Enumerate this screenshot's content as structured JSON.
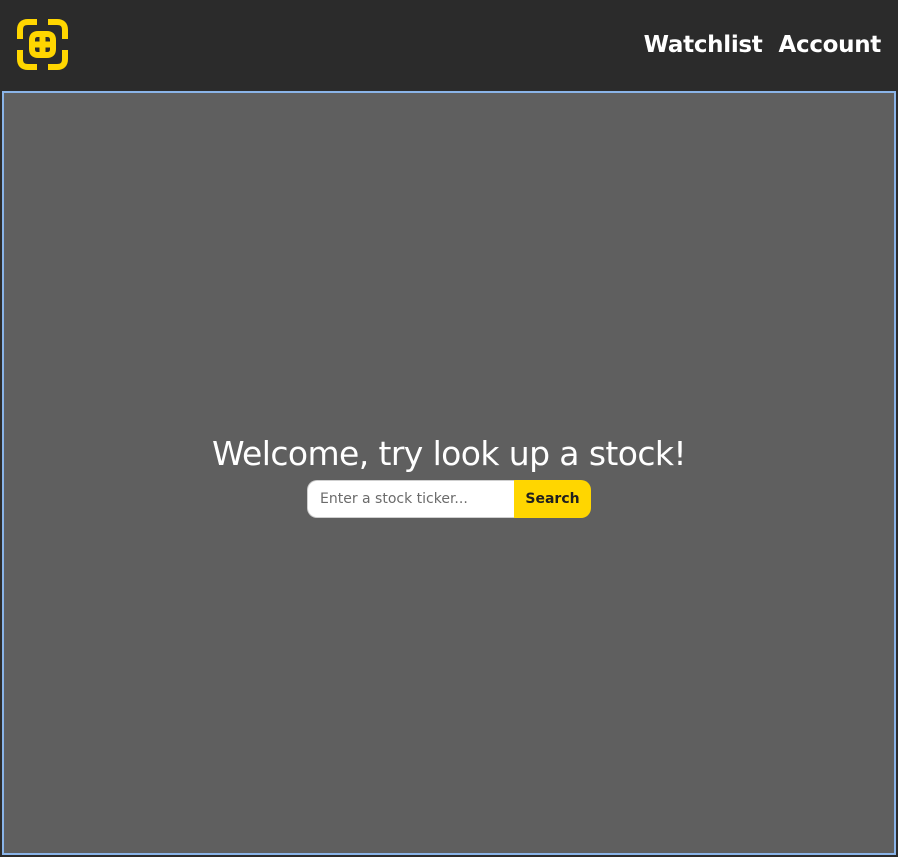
{
  "brand": {
    "logo_icon": "crosshair-grid-logo-icon",
    "accent_color": "#ffd600"
  },
  "nav": {
    "items": [
      {
        "label": "Watchlist"
      },
      {
        "label": "Account"
      }
    ]
  },
  "main": {
    "heading": "Welcome, try look up a stock!",
    "search": {
      "placeholder": "Enter a stock ticker...",
      "value": "",
      "button_label": "Search"
    }
  },
  "colors": {
    "navbar_bg": "#2b2b2b",
    "main_bg": "#5f5f5f",
    "main_border": "#8ab4e8",
    "text": "#ffffff"
  }
}
